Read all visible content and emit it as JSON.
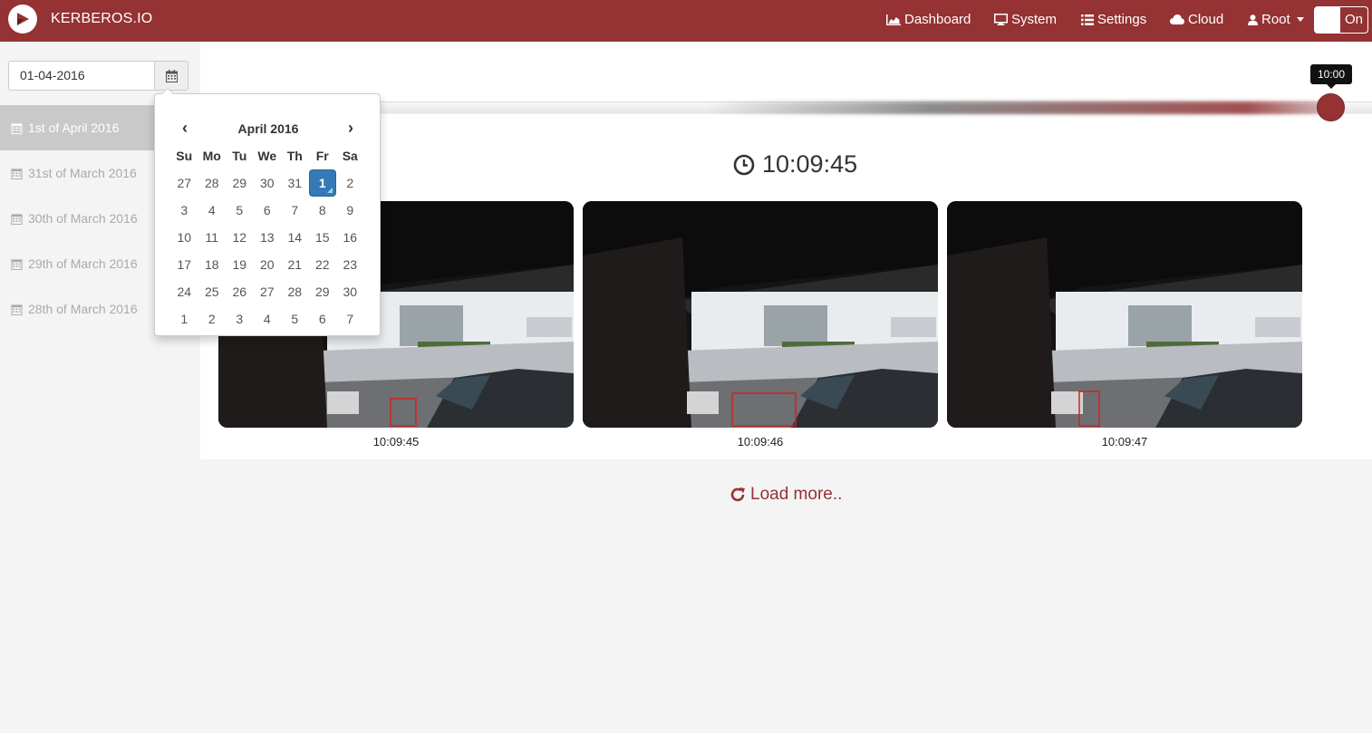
{
  "app": {
    "brand": "KERBEROS.IO"
  },
  "nav": {
    "dashboard": "Dashboard",
    "system": "System",
    "settings": "Settings",
    "cloud": "Cloud",
    "user": "Root",
    "toggle_label": "On"
  },
  "sidebar": {
    "date_value": "01-04-2016",
    "days": [
      {
        "label": "1st of April 2016",
        "active": true
      },
      {
        "label": "31st of March 2016",
        "active": false
      },
      {
        "label": "30th of March 2016",
        "active": false
      },
      {
        "label": "29th of March 2016",
        "active": false
      },
      {
        "label": "28th of March 2016",
        "active": false
      }
    ]
  },
  "datepicker": {
    "prev": "‹",
    "next": "›",
    "title": "April 2016",
    "weekdays": [
      "Su",
      "Mo",
      "Tu",
      "We",
      "Th",
      "Fr",
      "Sa"
    ],
    "weeks": [
      [
        "27",
        "28",
        "29",
        "30",
        "31",
        "1",
        "2"
      ],
      [
        "3",
        "4",
        "5",
        "6",
        "7",
        "8",
        "9"
      ],
      [
        "10",
        "11",
        "12",
        "13",
        "14",
        "15",
        "16"
      ],
      [
        "17",
        "18",
        "19",
        "20",
        "21",
        "22",
        "23"
      ],
      [
        "24",
        "25",
        "26",
        "27",
        "28",
        "29",
        "30"
      ],
      [
        "1",
        "2",
        "3",
        "4",
        "5",
        "6",
        "7"
      ]
    ],
    "selected_day": "1"
  },
  "timeline": {
    "tooltip": "10:00"
  },
  "main": {
    "current_time": "10:09:45",
    "shots": [
      {
        "time": "10:09:45"
      },
      {
        "time": "10:09:46"
      },
      {
        "time": "10:09:47"
      }
    ],
    "load_more": "Load more.."
  },
  "colors": {
    "brand": "#943234",
    "selected": "#337ab7"
  }
}
